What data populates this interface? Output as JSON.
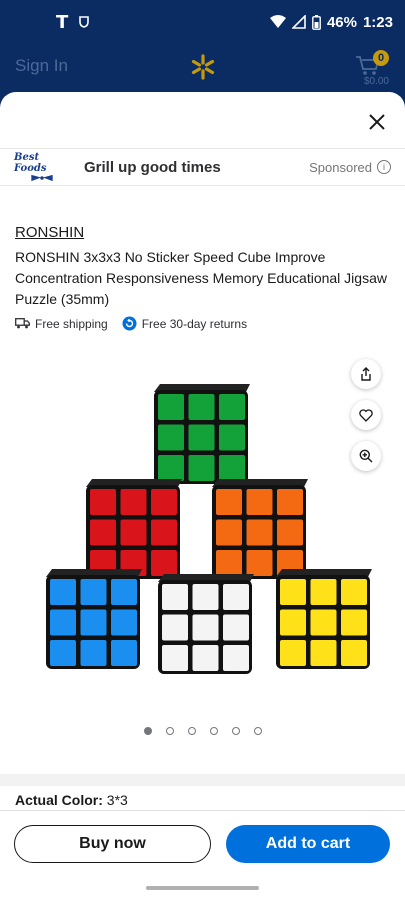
{
  "status_bar": {
    "carrier": "T",
    "battery": "46%",
    "time": "1:23"
  },
  "app_header": {
    "sign_in": "Sign In",
    "cart_count": "0",
    "cart_total": "$0.00"
  },
  "sponsor": {
    "brand": "Best Foods",
    "title": "Grill up good times",
    "label": "Sponsored"
  },
  "product": {
    "brand": "RONSHIN",
    "title": "RONSHIN 3x3x3 No  Sticker  Speed  Cube Improve Concentration Responsiveness Memory Educational Jigsaw Puzzle (35mm)",
    "shipping": "Free shipping",
    "returns": "Free 30-day returns",
    "image_count": 6,
    "active_image": 1,
    "actual_color_label": "Actual Color:",
    "actual_color_value": "3*3"
  },
  "actions": {
    "buy_now": "Buy now",
    "add_to_cart": "Add to cart"
  },
  "colors": {
    "walmart_blue": "#0071dc",
    "header_navy": "#0b2c63",
    "spark_yellow": "#c69a0c"
  }
}
